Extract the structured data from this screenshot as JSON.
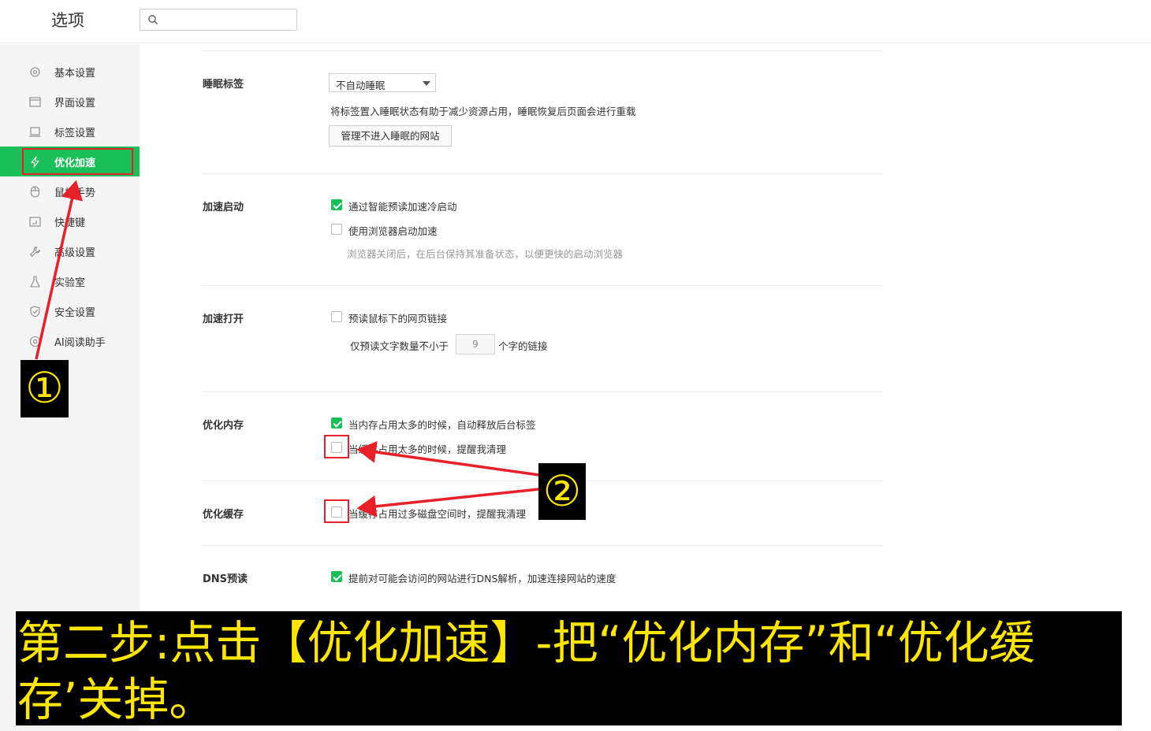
{
  "app": {
    "title": "选项"
  },
  "search": {
    "placeholder": "",
    "value": ""
  },
  "sidebar": {
    "items": [
      {
        "label": "基本设置",
        "icon": "gear-icon"
      },
      {
        "label": "界面设置",
        "icon": "window-icon"
      },
      {
        "label": "标签设置",
        "icon": "tab-icon"
      },
      {
        "label": "优化加速",
        "icon": "lightning-icon",
        "active": true
      },
      {
        "label": "鼠标手势",
        "icon": "mouse-icon"
      },
      {
        "label": "快捷键",
        "icon": "keyboard-icon"
      },
      {
        "label": "高级设置",
        "icon": "wrench-icon"
      },
      {
        "label": "实验室",
        "icon": "flask-icon"
      },
      {
        "label": "安全设置",
        "icon": "shield-icon"
      },
      {
        "label": "AI阅读助手",
        "icon": "ai-assistant-icon"
      }
    ]
  },
  "sections": {
    "sleep": {
      "title": "睡眠标签",
      "select_value": "不自动睡眠",
      "description": "将标签置入睡眠状态有助于减少资源占用，睡眠恢复后页面会进行重载",
      "button_label": "管理不进入睡眠的网站"
    },
    "startup": {
      "title": "加速启动",
      "options": [
        {
          "label": "通过智能预读加速冷启动",
          "checked": true
        },
        {
          "label": "使用浏览器启动加速",
          "checked": false
        }
      ],
      "hint": "浏览器关闭后，在后台保持其准备状态，以便更快的启动浏览器"
    },
    "open": {
      "title": "加速打开",
      "option": {
        "label": "预读鼠标下的网页链接",
        "checked": false
      },
      "min_prefix": "仅预读文字数量不小于",
      "min_value": "9",
      "min_suffix": "个字的链接"
    },
    "memory": {
      "title": "优化内存",
      "options": [
        {
          "label": "当内存占用太多的时候，自动释放后台标签",
          "checked": true
        },
        {
          "label": "当缓存占用太多的时候，提醒我清理",
          "checked": false
        }
      ]
    },
    "cache": {
      "title": "优化缓存",
      "option": {
        "label": "当缓存占用过多磁盘空间时，提醒我清理",
        "checked": false
      }
    },
    "dns": {
      "title": "DNS预读",
      "option": {
        "label": "提前对可能会访问的网站进行DNS解析，加速连接网站的速度",
        "checked": true
      }
    }
  },
  "annotations": {
    "step1_badge": "①",
    "step2_badge": "②",
    "caption": "第二步:点击【优化加速】-把“优化内存”和“优化缓存’关掉。"
  },
  "colors": {
    "accent_green": "#1bbf5a",
    "annotation_red": "#e8202a",
    "caption_yellow": "#ffe600",
    "caption_bg": "#000000"
  }
}
